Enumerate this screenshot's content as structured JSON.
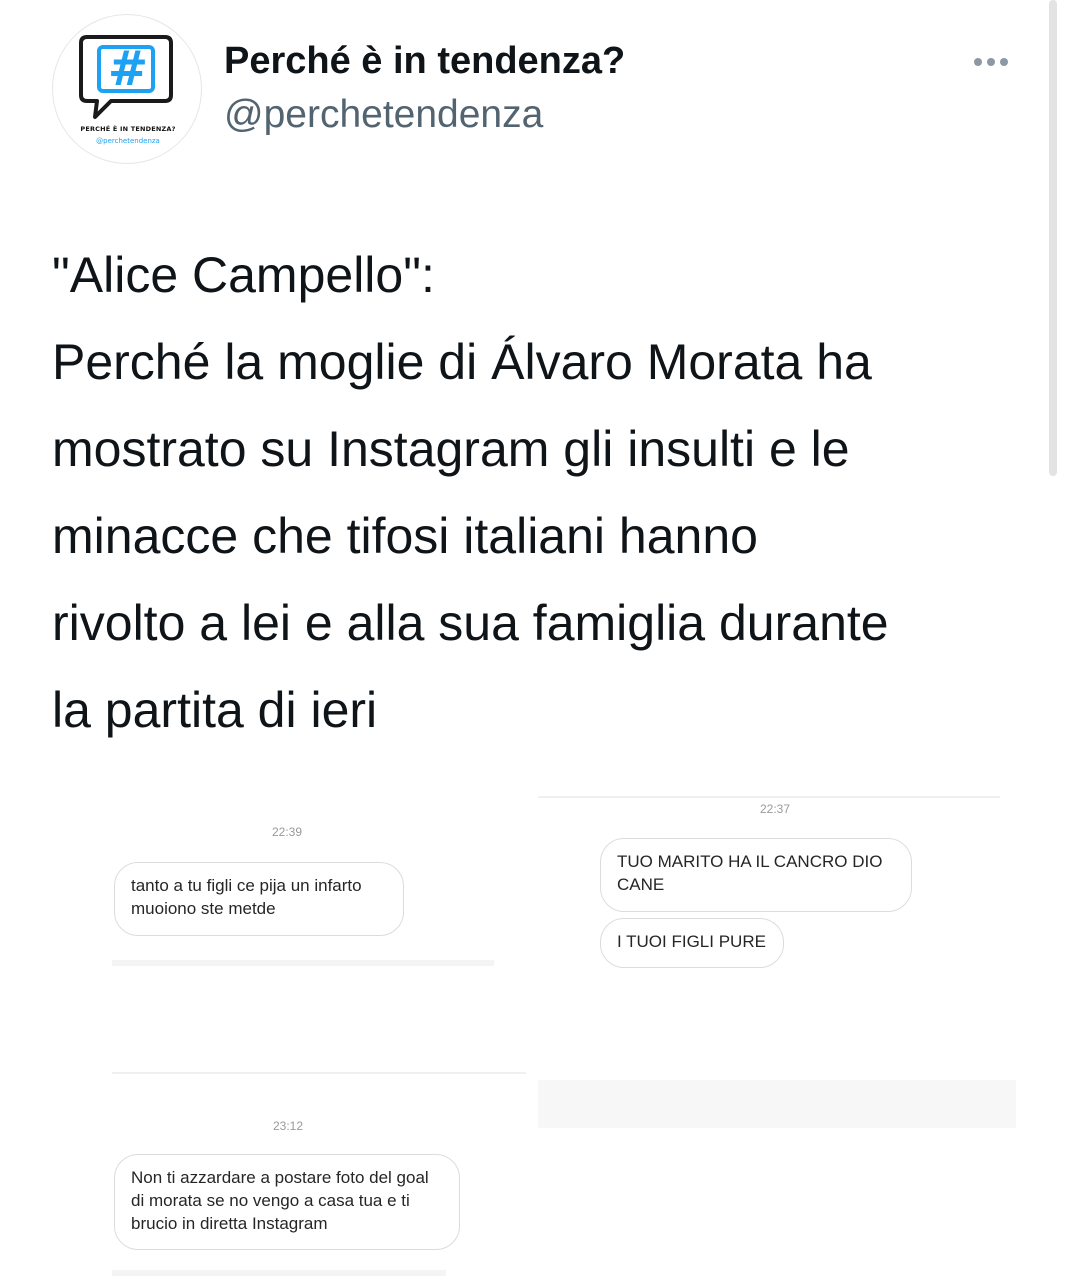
{
  "tweet": {
    "author": {
      "display_name": "Perché è in tendenza?",
      "handle": "@perchetendenza",
      "avatar": {
        "symbol": "#",
        "caption": "PERCHÉ È IN TENDENZA?",
        "handle": "@perchetendenza",
        "accent_color": "#1da1f2"
      }
    },
    "menu_icon": "more-horizontal-icon",
    "text_lines": [
      "\"Alice Campello\":",
      "Perché la moglie di Álvaro Morata ha",
      "mostrato su Instagram gli insulti e le",
      "minacce che tifosi italiani hanno",
      "rivolto a lei e alla sua famiglia durante",
      "la partita di ieri"
    ]
  },
  "screenshots": [
    {
      "time": "22:39",
      "messages": [
        "tanto a tu figli ce pija un infarto muoiono ste metde"
      ]
    },
    {
      "time": "22:37",
      "messages": [
        "TUO MARITO HA IL CANCRO DIO CANE",
        "I TUOI FIGLI PURE"
      ]
    },
    {
      "time": "23:12",
      "messages": [
        "Non ti azzardare a postare foto del goal di morata se no vengo a casa tua e ti brucio in diretta Instagram"
      ]
    }
  ],
  "colors": {
    "text_primary": "#0f1419",
    "text_secondary": "#536471",
    "accent": "#1da1f2"
  }
}
